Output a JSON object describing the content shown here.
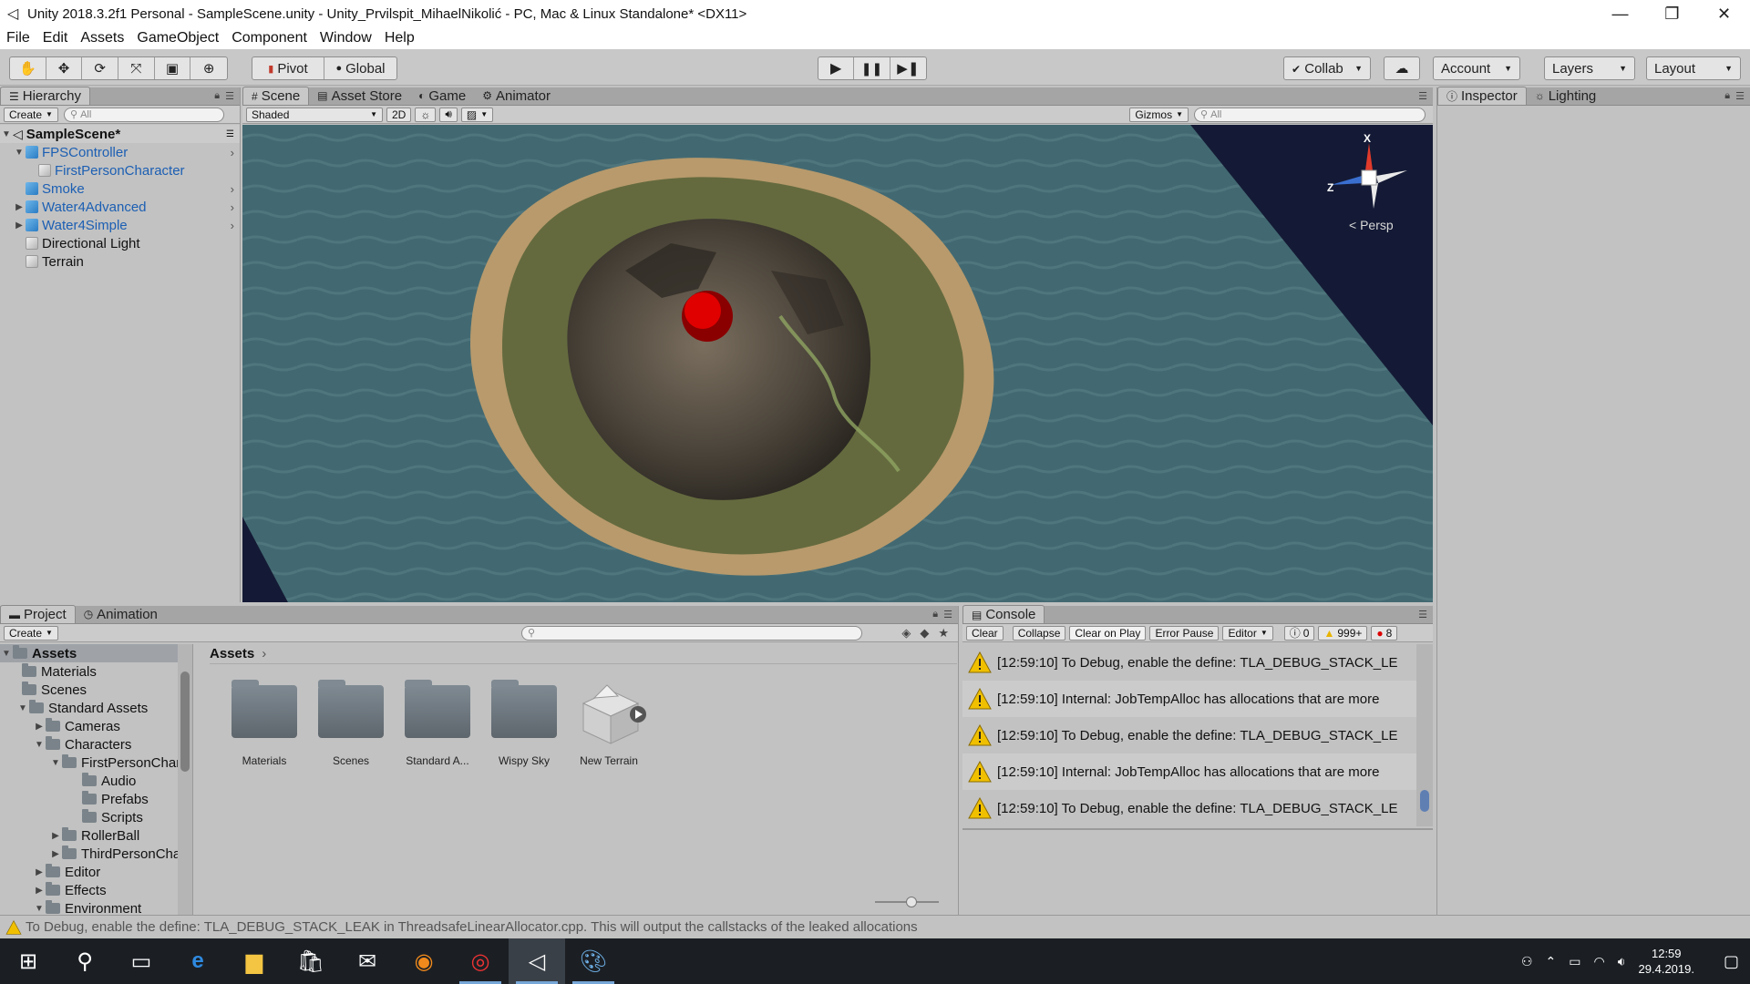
{
  "window": {
    "title": "Unity 2018.3.2f1 Personal - SampleScene.unity - Unity_Prvilspit_MihaelNikolić - PC, Mac & Linux Standalone* <DX11>"
  },
  "menu": [
    "File",
    "Edit",
    "Assets",
    "GameObject",
    "Component",
    "Window",
    "Help"
  ],
  "toolbar": {
    "pivot": "Pivot",
    "global": "Global",
    "collab": "Collab",
    "account": "Account",
    "layers": "Layers",
    "layout": "Layout"
  },
  "hierarchy": {
    "tab": "Hierarchy",
    "create": "Create",
    "search_placeholder": "All",
    "scene": "SampleScene*",
    "items": [
      "FPSController",
      "FirstPersonCharacter",
      "Smoke",
      "Water4Advanced",
      "Water4Simple",
      "Directional Light",
      "Terrain"
    ]
  },
  "scene_tabs": [
    "Scene",
    "Asset Store",
    "Game",
    "Animator"
  ],
  "scene_bar": {
    "shading": "Shaded",
    "mode2d": "2D",
    "gizmos": "Gizmos",
    "search_placeholder": "All"
  },
  "gizmo": {
    "x": "X",
    "z": "Z",
    "persp": "Persp"
  },
  "inspector_tabs": [
    "Inspector",
    "Lighting"
  ],
  "project": {
    "tabs": [
      "Project",
      "Animation"
    ],
    "create": "Create",
    "breadcrumb": "Assets",
    "tree": [
      "Assets",
      "Materials",
      "Scenes",
      "Standard Assets",
      "Cameras",
      "Characters",
      "FirstPersonChara",
      "Audio",
      "Prefabs",
      "Scripts",
      "RollerBall",
      "ThirdPersonChar",
      "Editor",
      "Effects",
      "Environment"
    ],
    "assets": [
      "Materials",
      "Scenes",
      "Standard A...",
      "Wispy Sky",
      "New Terrain"
    ]
  },
  "console": {
    "tab": "Console",
    "buttons": [
      "Clear",
      "Collapse",
      "Clear on Play",
      "Error Pause",
      "Editor"
    ],
    "count_info": "0",
    "count_warn": "999+",
    "count_error": "8",
    "messages": [
      "[12:59:10] To Debug, enable the define: TLA_DEBUG_STACK_LE",
      "[12:59:10] Internal: JobTempAlloc has allocations that are more",
      "[12:59:10] To Debug, enable the define: TLA_DEBUG_STACK_LE",
      "[12:59:10] Internal: JobTempAlloc has allocations that are more",
      "[12:59:10] To Debug, enable the define: TLA_DEBUG_STACK_LE"
    ]
  },
  "status": {
    "message": "To Debug, enable the define: TLA_DEBUG_STACK_LEAK in ThreadsafeLinearAllocator.cpp. This will output the callstacks of the leaked allocations"
  },
  "taskbar": {
    "time": "12:59",
    "date": "29.4.2019."
  }
}
